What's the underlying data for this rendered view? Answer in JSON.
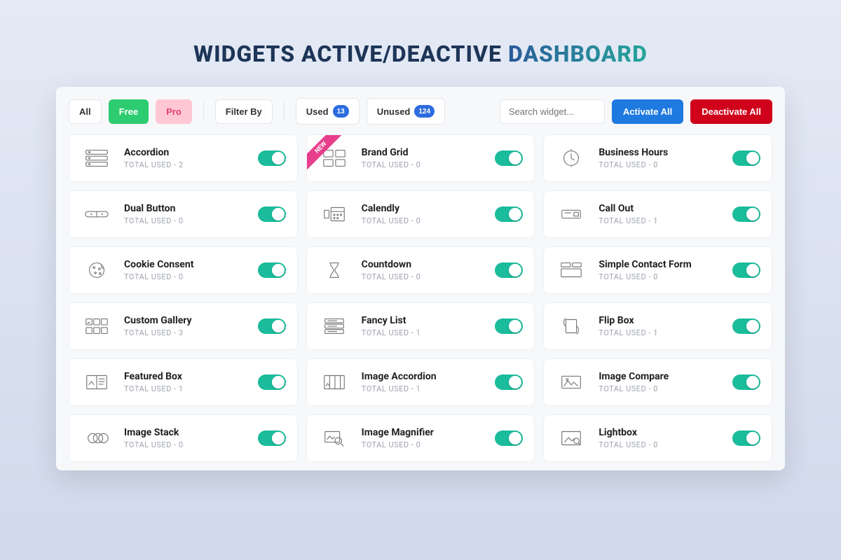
{
  "page_title_main": "WIDGETS ACTIVE/DEACTIVE ",
  "page_title_accent": "DASHBOARD",
  "toolbar": {
    "all_label": "All",
    "free_label": "Free",
    "pro_label": "Pro",
    "filter_label": "Filter By",
    "used_label": "Used",
    "used_count": "13",
    "unused_label": "Unused",
    "unused_count": "124",
    "search_placeholder": "Search widget...",
    "activate_all": "Activate All",
    "deactivate_all": "Deactivate All"
  },
  "total_used_prefix": "TOTAL USED - ",
  "new_badge": "NEW",
  "widgets": [
    {
      "name": "Accordion",
      "used": 2,
      "icon": "accordion-icon",
      "new": false
    },
    {
      "name": "Brand Grid",
      "used": 0,
      "icon": "grid-icon",
      "new": true
    },
    {
      "name": "Business Hours",
      "used": 0,
      "icon": "clock-icon",
      "new": false
    },
    {
      "name": "Dual Button",
      "used": 0,
      "icon": "dual-button-icon",
      "new": false
    },
    {
      "name": "Calendly",
      "used": 0,
      "icon": "calendar-icon",
      "new": false
    },
    {
      "name": "Call Out",
      "used": 1,
      "icon": "callout-icon",
      "new": false
    },
    {
      "name": "Cookie Consent",
      "used": 0,
      "icon": "cookie-icon",
      "new": false
    },
    {
      "name": "Countdown",
      "used": 0,
      "icon": "hourglass-icon",
      "new": false
    },
    {
      "name": "Simple Contact Form",
      "used": 0,
      "icon": "form-icon",
      "new": false
    },
    {
      "name": "Custom Gallery",
      "used": 3,
      "icon": "gallery-icon",
      "new": false
    },
    {
      "name": "Fancy List",
      "used": 1,
      "icon": "list-icon",
      "new": false
    },
    {
      "name": "Flip Box",
      "used": 1,
      "icon": "flip-icon",
      "new": false
    },
    {
      "name": "Featured Box",
      "used": 1,
      "icon": "featured-icon",
      "new": false
    },
    {
      "name": "Image Accordion",
      "used": 1,
      "icon": "image-accordion-icon",
      "new": false
    },
    {
      "name": "Image Compare",
      "used": 0,
      "icon": "image-compare-icon",
      "new": false
    },
    {
      "name": "Image Stack",
      "used": 0,
      "icon": "image-stack-icon",
      "new": false
    },
    {
      "name": "Image Magnifier",
      "used": 0,
      "icon": "magnifier-icon",
      "new": false
    },
    {
      "name": "Lightbox",
      "used": 0,
      "icon": "lightbox-icon",
      "new": false
    }
  ]
}
